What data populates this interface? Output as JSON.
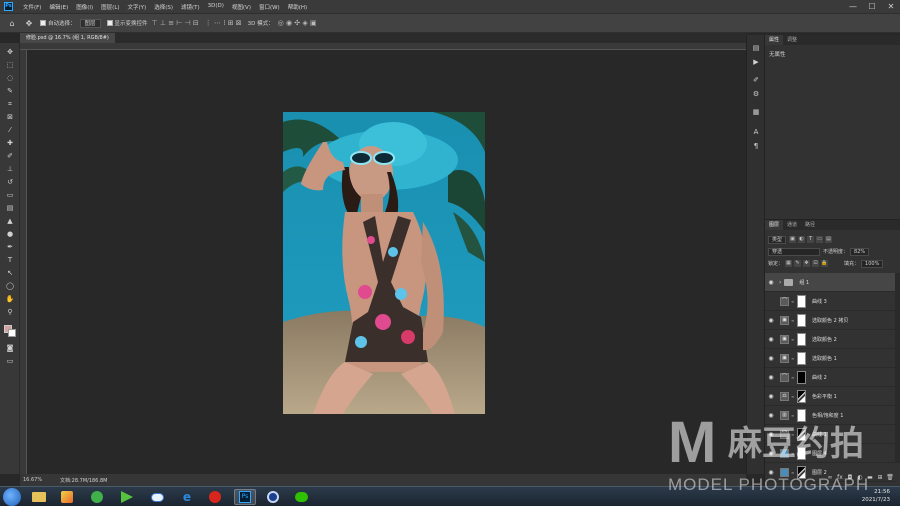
{
  "menu": [
    "文件(F)",
    "编辑(E)",
    "图像(I)",
    "图层(L)",
    "文字(Y)",
    "选择(S)",
    "滤镜(T)",
    "3D(D)",
    "视图(V)",
    "窗口(W)",
    "帮助(H)"
  ],
  "window_controls": {
    "minimize": "—",
    "maximize": "☐",
    "close": "✕"
  },
  "options": {
    "auto_select_label": "自动选择：",
    "auto_select_value": "图层",
    "show_transform_label": "显示变换控件",
    "mode_3d_label": "3D 模式："
  },
  "document_tab": "修脸.psd @ 16.7% (组 1, RGB/8#)",
  "status": {
    "zoom": "16.67%",
    "doc_size": "文档:28.7M/186.8M"
  },
  "properties_panel": {
    "tabs": [
      "属性",
      "调整"
    ],
    "no_attributes": "无属性"
  },
  "layers_panel": {
    "tabs": [
      "图层",
      "通道",
      "路径"
    ],
    "kind_filter": "类型",
    "blend_mode": "穿透",
    "opacity_label": "不透明度：",
    "opacity_value": "82%",
    "lock_label": "锁定：",
    "fill_label": "填充：",
    "fill_value": "100%",
    "layers": [
      {
        "name": "组 1",
        "type": "group",
        "visible": true,
        "selected": true
      },
      {
        "name": "曲线 3",
        "type": "adjust",
        "icon": "curves",
        "visible": false,
        "mask": "white"
      },
      {
        "name": "选取颜色 2 拷贝",
        "type": "adjust",
        "icon": "selective",
        "visible": true,
        "mask": "white"
      },
      {
        "name": "选取颜色 2",
        "type": "adjust",
        "icon": "selective",
        "visible": true,
        "mask": "white"
      },
      {
        "name": "选取颜色 1",
        "type": "adjust",
        "icon": "selective",
        "visible": true,
        "mask": "white"
      },
      {
        "name": "曲线 2",
        "type": "adjust",
        "icon": "curves",
        "visible": true,
        "mask": "black"
      },
      {
        "name": "色彩平衡 1",
        "type": "adjust",
        "icon": "balance",
        "visible": true,
        "mask": "mixed"
      },
      {
        "name": "色相/饱和度 1",
        "type": "adjust",
        "icon": "hue",
        "visible": true,
        "mask": "white"
      },
      {
        "name": "曲线 1",
        "type": "adjust",
        "icon": "curves",
        "visible": true,
        "mask": "mixed"
      },
      {
        "name": "图层 4",
        "type": "pixel",
        "visible": true,
        "mask": "white"
      },
      {
        "name": "图层 2",
        "type": "pixel",
        "visible": true,
        "mask": "mixed"
      }
    ]
  },
  "taskbar": {
    "clock_time": "21:56",
    "clock_date": "2021/7/23"
  },
  "watermark": {
    "letter": "M",
    "chinese": "麻豆约拍",
    "english": "MODEL PHOTOGRAPH"
  },
  "colors": {
    "foreground": "#d9a0a0",
    "background": "#ffffff",
    "ps_blue": "#31a8ff"
  }
}
